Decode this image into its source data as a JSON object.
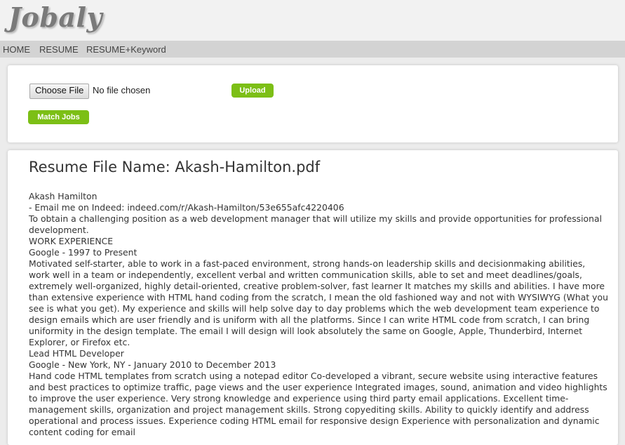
{
  "header": {
    "logo": "Jobaly"
  },
  "nav": {
    "items": [
      "HOME",
      "RESUME",
      "RESUME+Keyword"
    ]
  },
  "upload": {
    "choose_label": "Choose File",
    "file_status": "No file chosen",
    "upload_label": "Upload",
    "match_label": "Match Jobs"
  },
  "resume": {
    "title": "Resume File Name: Akash-Hamilton.pdf",
    "lines": [
      "Akash Hamilton",
      "- Email me on Indeed: indeed.com/r/Akash-Hamilton/53e655afc4220406",
      "To obtain a challenging position as a web development manager that will utilize my skills and provide opportunities for professional development.",
      "WORK EXPERIENCE",
      "Google - 1997 to Present",
      "Motivated self-starter, able to work in a fast-paced environment, strong hands-on leadership skills and decisionmaking abilities, work well in a team or independently, excellent verbal and written communication skills, able to set and meet deadlines/goals, extremely well-organized, highly detail-oriented, creative problem-solver, fast learner It matches my skills and abilities. I have more than extensive experience with HTML hand coding from the scratch, I mean the old fashioned way and not with WYSIWYG (What you see is what you get). My experience and skills will help solve day to day problems which the web development team experience to design emails which are user friendly and is uniform with all the platforms. Since I can write HTML code from scratch, I can bring uniformity in the design template. The email I will design will look absolutely the same on Google, Apple, Thunderbird, Internet Explorer, or Firefox etc.",
      "Lead HTML Developer",
      "Google - New York, NY - January 2010 to December 2013",
      "Hand code HTML templates from scratch using a notepad editor Co-developed a vibrant, secure website using interactive features and best practices to optimize traffic, page views and the user experience Integrated images, sound, animation and video highlights to improve the user experience. Very strong knowledge and experience using third party email applications. Excellent time-management skills, organization and project management skills. Strong copyediting skills. Ability to quickly identify and address operational and process issues. Experience coding HTML email for responsive design Experience with personalization and dynamic content coding for email"
    ]
  }
}
